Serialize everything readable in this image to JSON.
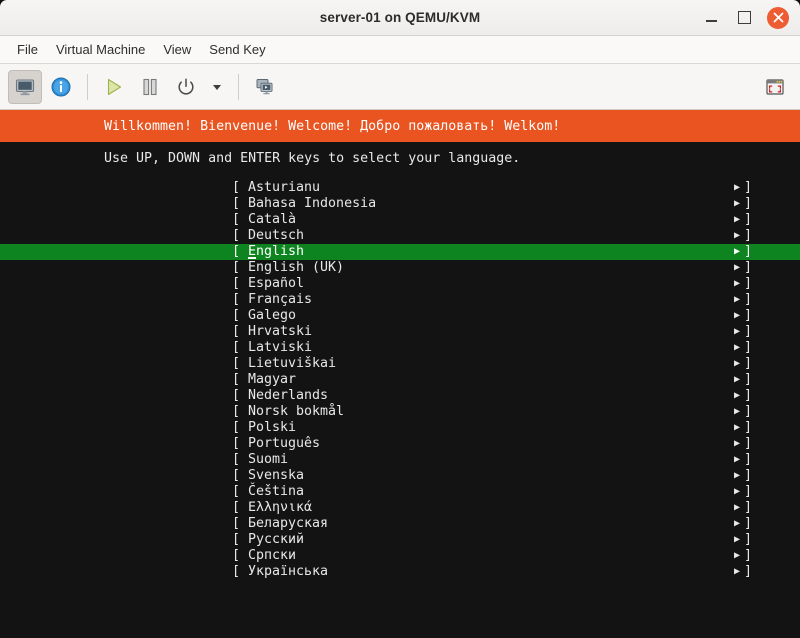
{
  "window": {
    "title": "server-01 on QEMU/KVM",
    "controls": {
      "minimize": "minimize",
      "maximize": "maximize",
      "close": "close"
    }
  },
  "menubar": {
    "items": [
      {
        "label": "File"
      },
      {
        "label": "Virtual Machine"
      },
      {
        "label": "View"
      },
      {
        "label": "Send Key"
      }
    ]
  },
  "toolbar": {
    "buttons": [
      {
        "name": "console-view-button",
        "icon": "monitor-icon",
        "active": true
      },
      {
        "name": "details-view-button",
        "icon": "info-icon",
        "active": false
      },
      {
        "name": "run-button",
        "icon": "play-icon",
        "active": false
      },
      {
        "name": "pause-button",
        "icon": "pause-icon",
        "active": false
      },
      {
        "name": "shutdown-button",
        "icon": "power-icon",
        "active": false
      },
      {
        "name": "shutdown-menu-button",
        "icon": "caret-down-icon",
        "active": false
      },
      {
        "name": "snapshots-button",
        "icon": "displays-icon",
        "active": false
      },
      {
        "name": "fullscreen-button",
        "icon": "fullscreen-icon",
        "active": false
      }
    ]
  },
  "console": {
    "banner_text": "Willkommen! Bienvenue! Welcome! Добро пожаловать! Welkom!",
    "instruction": "Use UP, DOWN and ENTER keys to select your language.",
    "bracket_left": "[",
    "bracket_right": "]",
    "arrow": "▶",
    "selected_index": 4,
    "languages": [
      "Asturianu",
      "Bahasa Indonesia",
      "Català",
      "Deutsch",
      "English",
      "English (UK)",
      "Español",
      "Français",
      "Galego",
      "Hrvatski",
      "Latviski",
      "Lietuviškai",
      "Magyar",
      "Nederlands",
      "Norsk bokmål",
      "Polski",
      "Português",
      "Suomi",
      "Svenska",
      "Čeština",
      "Ελληνικά",
      "Беларуская",
      "Русский",
      "Српски",
      "Українська"
    ]
  },
  "colors": {
    "banner_orange": "#e95420",
    "selection_green": "#0e8420",
    "console_black": "#131313",
    "close_button": "#ed5c32"
  }
}
